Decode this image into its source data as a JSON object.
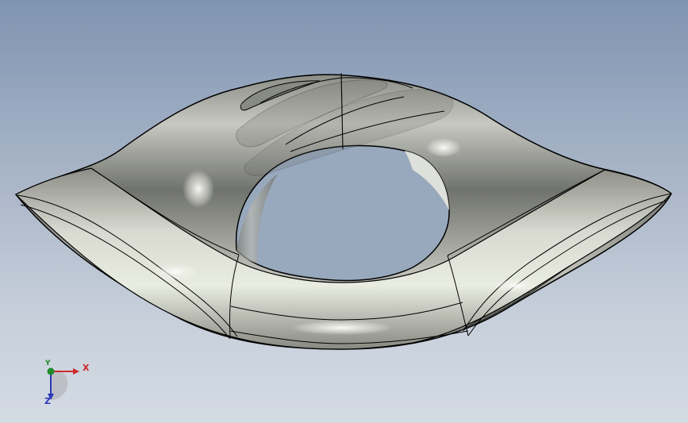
{
  "viewport": {
    "background_top": "#7f94b2",
    "background_bottom": "#d4dbe3"
  },
  "model": {
    "shape": "ring-shaped saddle/handle",
    "color": "#d8dad0"
  },
  "triad": {
    "x_label": "X",
    "y_label": "Y",
    "z_label": "Z",
    "x_color": "#cc2a2a",
    "y_color": "#1f8a2a",
    "z_color": "#2c37b8",
    "icon": "axis-triad-icon"
  }
}
